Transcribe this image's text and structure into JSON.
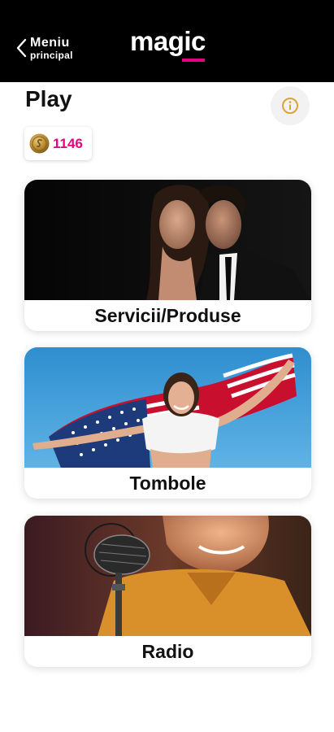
{
  "header": {
    "back_label_line1": "Meniu",
    "back_label_line2": "principal",
    "logo_text": "magic",
    "accent_color": "#e6007e",
    "background_color": "#000000"
  },
  "page": {
    "title": "Play",
    "info_icon": "info-icon"
  },
  "points": {
    "icon": "coin-icon",
    "value": "1146"
  },
  "cards": [
    {
      "label": "Servicii/Produse",
      "image": "couple-photo"
    },
    {
      "label": "Tombole",
      "image": "woman-with-us-flag-photo"
    },
    {
      "label": "Radio",
      "image": "radio-microphone-photo"
    }
  ]
}
